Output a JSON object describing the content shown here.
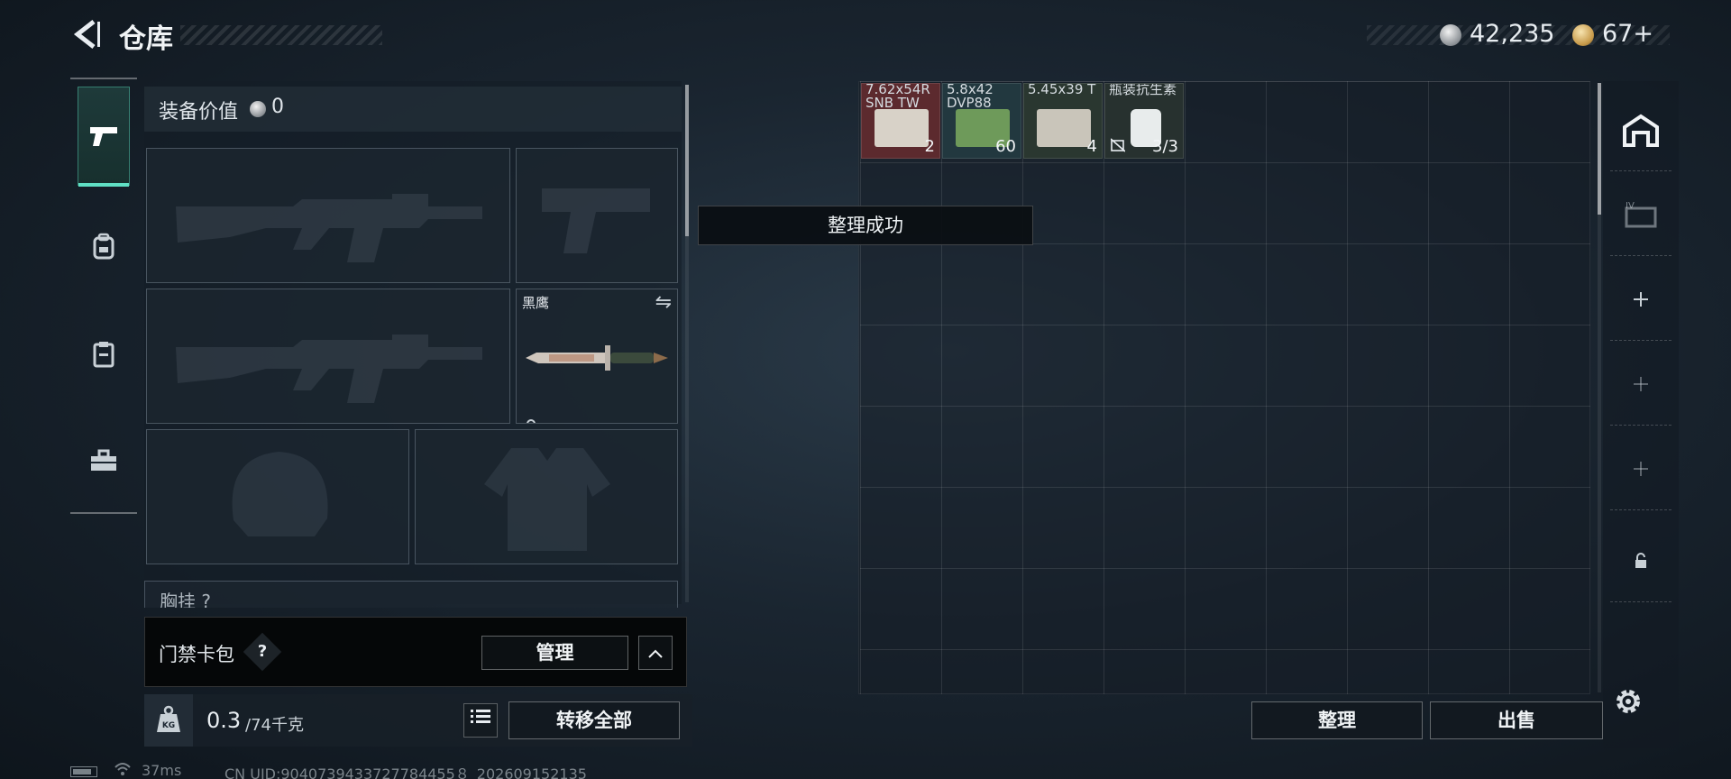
{
  "header": {
    "title": "仓库",
    "currency_silver": "42,235",
    "currency_gold": "67+"
  },
  "rail": {
    "tabs": [
      {
        "icon": "pistol-icon",
        "active": true
      },
      {
        "icon": "backpack-icon",
        "active": false
      },
      {
        "icon": "clipboard-icon",
        "active": false
      },
      {
        "icon": "toolbox-icon",
        "active": false
      }
    ]
  },
  "equipment": {
    "value_label": "装备价值",
    "value": "0",
    "knife_label": "黑鹰",
    "chest_rig_label": "胸挂 ?"
  },
  "card_bag": {
    "label": "门禁卡包",
    "help": "?",
    "manage": "管理"
  },
  "weight": {
    "current": "0.3",
    "max": "/74千克",
    "transfer_all": "转移全部"
  },
  "toast": "整理成功",
  "storage": {
    "items": [
      {
        "name": "7.62x54R SNB TW",
        "count": "2",
        "color": "#7a3538"
      },
      {
        "name": "5.8x42 DVP88",
        "count": "60",
        "color": "#2c4a52"
      },
      {
        "name": "5.45x39 T",
        "count": "4",
        "color": "#3a4a3e"
      },
      {
        "name": "瓶装抗生素",
        "count": "3/3",
        "color": "#33403e"
      }
    ],
    "sort": "整理",
    "sell": "出售"
  },
  "status": {
    "ping": "37ms",
    "uid": "CN UID:9040739433727784455８_202609152135"
  },
  "colors": {
    "accent": "#5fe0c4",
    "background": "#1a2530"
  }
}
